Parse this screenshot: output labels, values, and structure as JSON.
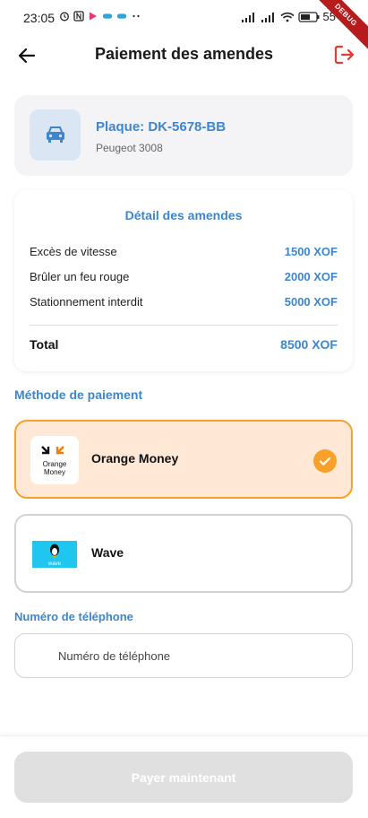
{
  "status_bar": {
    "time": "23:05",
    "battery": "55"
  },
  "debug_label": "DEBUG",
  "header": {
    "title": "Paiement des amendes"
  },
  "vehicle": {
    "plate": "Plaque: DK-5678-BB",
    "model": "Peugeot 3008"
  },
  "fines": {
    "title": "Détail des amendes",
    "items": [
      {
        "label": "Excès de vitesse",
        "amount": "1500 XOF"
      },
      {
        "label": "Brûler un feu rouge",
        "amount": "2000 XOF"
      },
      {
        "label": "Stationnement interdit",
        "amount": "5000 XOF"
      }
    ],
    "total_label": "Total",
    "total_value": "8500 XOF"
  },
  "payment": {
    "section_label": "Méthode de paiement",
    "options": [
      {
        "name": "Orange Money",
        "logo_text_1": "Orange",
        "logo_text_2": "Money",
        "selected": true
      },
      {
        "name": "Wave",
        "logo_text": "wave",
        "selected": false
      }
    ]
  },
  "phone": {
    "label": "Numéro de téléphone",
    "placeholder": "Numéro de téléphone",
    "value": ""
  },
  "submit": {
    "label": "Payer maintenant"
  },
  "colors": {
    "accent": "#3d86cf",
    "orange": "#f7a12b",
    "logout": "#e53935"
  }
}
